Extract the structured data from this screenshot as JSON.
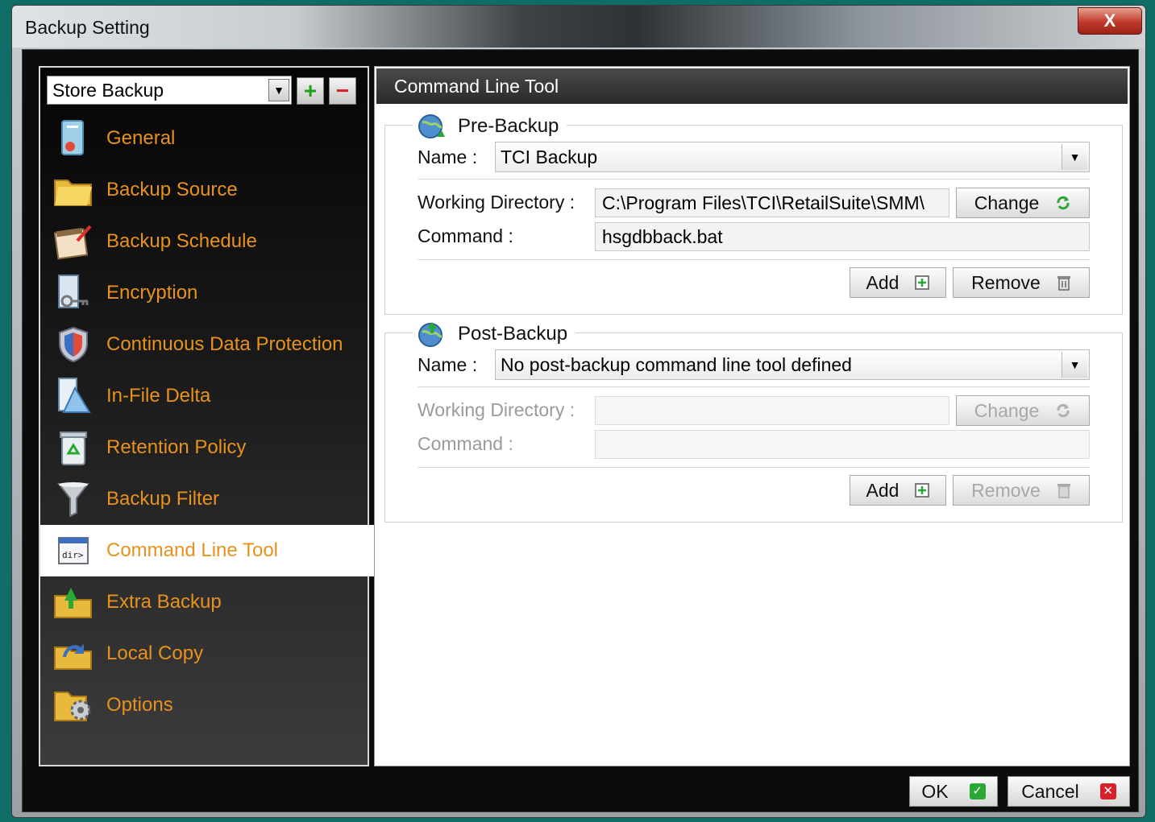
{
  "window": {
    "title": "Backup Setting",
    "close_glyph": "X"
  },
  "left": {
    "combo_value": "Store Backup",
    "combo_arrow": "▼",
    "plus_glyph": "+",
    "minus_glyph": "−",
    "nav": [
      {
        "label": "General",
        "icon": "general-icon"
      },
      {
        "label": "Backup Source",
        "icon": "folder-icon"
      },
      {
        "label": "Backup Schedule",
        "icon": "calendar-icon"
      },
      {
        "label": "Encryption",
        "icon": "key-icon"
      },
      {
        "label": "Continuous Data Protection",
        "icon": "shield-icon"
      },
      {
        "label": "In-File Delta",
        "icon": "delta-icon"
      },
      {
        "label": "Retention Policy",
        "icon": "recycle-bin-icon"
      },
      {
        "label": "Backup Filter",
        "icon": "funnel-icon"
      },
      {
        "label": "Command Line Tool",
        "icon": "command-prompt-icon"
      },
      {
        "label": "Extra Backup",
        "icon": "extra-backup-icon"
      },
      {
        "label": "Local Copy",
        "icon": "local-copy-icon"
      },
      {
        "label": "Options",
        "icon": "options-gear-icon"
      }
    ],
    "active_index": 8
  },
  "content": {
    "header": "Command Line Tool",
    "pre": {
      "legend": "Pre-Backup",
      "name_label": "Name :",
      "name_value": "TCI Backup",
      "wd_label": "Working Directory :",
      "wd_value": "C:\\Program Files\\TCI\\RetailSuite\\SMM\\",
      "change_label": "Change",
      "cmd_label": "Command :",
      "cmd_value": "hsgdbback.bat",
      "add_label": "Add",
      "remove_label": "Remove"
    },
    "post": {
      "legend": "Post-Backup",
      "name_label": "Name :",
      "name_value": "No post-backup command line tool defined",
      "wd_label": "Working Directory :",
      "wd_value": "",
      "change_label": "Change",
      "cmd_label": "Command :",
      "cmd_value": "",
      "add_label": "Add",
      "remove_label": "Remove"
    },
    "select_arrow": "▼"
  },
  "footer": {
    "ok_label": "OK",
    "cancel_label": "Cancel",
    "ok_glyph": "✓",
    "cancel_glyph": "✕"
  },
  "colors": {
    "accent_orange": "#e8921e",
    "ok_green": "#2aa836",
    "cancel_red": "#d6202a"
  }
}
